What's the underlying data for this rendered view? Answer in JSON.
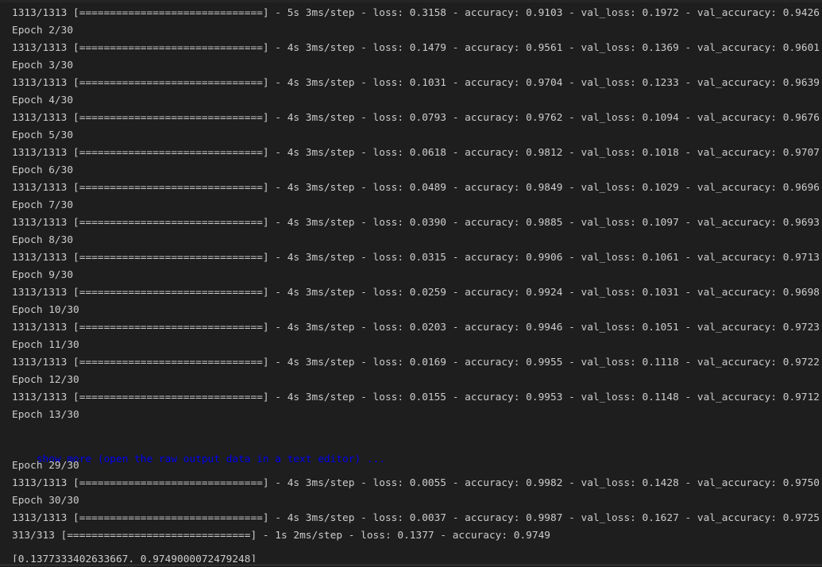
{
  "output": {
    "lines_before": [
      "1313/1313 [==============================] - 5s 3ms/step - loss: 0.3158 - accuracy: 0.9103 - val_loss: 0.1972 - val_accuracy: 0.9426",
      "Epoch 2/30",
      "1313/1313 [==============================] - 4s 3ms/step - loss: 0.1479 - accuracy: 0.9561 - val_loss: 0.1369 - val_accuracy: 0.9601",
      "Epoch 3/30",
      "1313/1313 [==============================] - 4s 3ms/step - loss: 0.1031 - accuracy: 0.9704 - val_loss: 0.1233 - val_accuracy: 0.9639",
      "Epoch 4/30",
      "1313/1313 [==============================] - 4s 3ms/step - loss: 0.0793 - accuracy: 0.9762 - val_loss: 0.1094 - val_accuracy: 0.9676",
      "Epoch 5/30",
      "1313/1313 [==============================] - 4s 3ms/step - loss: 0.0618 - accuracy: 0.9812 - val_loss: 0.1018 - val_accuracy: 0.9707",
      "Epoch 6/30",
      "1313/1313 [==============================] - 4s 3ms/step - loss: 0.0489 - accuracy: 0.9849 - val_loss: 0.1029 - val_accuracy: 0.9696",
      "Epoch 7/30",
      "1313/1313 [==============================] - 4s 3ms/step - loss: 0.0390 - accuracy: 0.9885 - val_loss: 0.1097 - val_accuracy: 0.9693",
      "Epoch 8/30",
      "1313/1313 [==============================] - 4s 3ms/step - loss: 0.0315 - accuracy: 0.9906 - val_loss: 0.1061 - val_accuracy: 0.9713",
      "Epoch 9/30",
      "1313/1313 [==============================] - 4s 3ms/step - loss: 0.0259 - accuracy: 0.9924 - val_loss: 0.1031 - val_accuracy: 0.9698",
      "Epoch 10/30",
      "1313/1313 [==============================] - 4s 3ms/step - loss: 0.0203 - accuracy: 0.9946 - val_loss: 0.1051 - val_accuracy: 0.9723",
      "Epoch 11/30",
      "1313/1313 [==============================] - 4s 3ms/step - loss: 0.0169 - accuracy: 0.9955 - val_loss: 0.1118 - val_accuracy: 0.9722",
      "Epoch 12/30",
      "1313/1313 [==============================] - 4s 3ms/step - loss: 0.0155 - accuracy: 0.9953 - val_loss: 0.1148 - val_accuracy: 0.9712",
      "Epoch 13/30"
    ],
    "truncation_link": "show more (open the raw output data in a text editor) ...",
    "lines_after": [
      "Epoch 29/30",
      "1313/1313 [==============================] - 4s 3ms/step - loss: 0.0055 - accuracy: 0.9982 - val_loss: 0.1428 - val_accuracy: 0.9750",
      "Epoch 30/30",
      "1313/1313 [==============================] - 4s 3ms/step - loss: 0.0037 - accuracy: 0.9987 - val_loss: 0.1627 - val_accuracy: 0.9725",
      "313/313 [==============================] - 1s 2ms/step - loss: 0.1377 - accuracy: 0.9749"
    ],
    "result_line": "[0.1377333402633667, 0.9749000072479248]"
  },
  "colors": {
    "background": "#1e1e1e",
    "text": "#cccccc",
    "link": "#0000ee"
  }
}
